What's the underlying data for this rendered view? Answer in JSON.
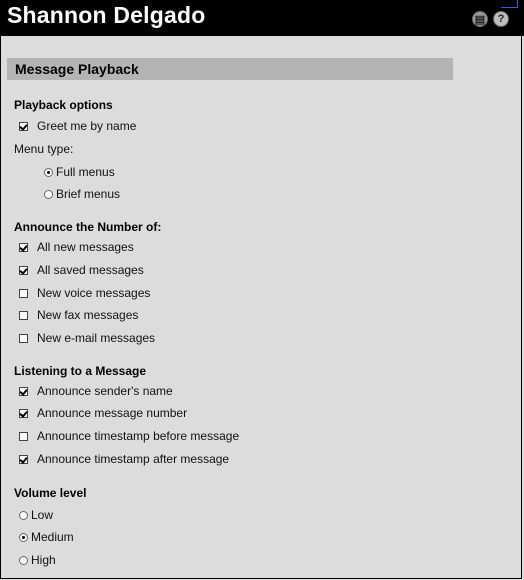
{
  "header": {
    "title": "Shannon Delgado",
    "print_icon": "print-icon",
    "help_icon": "help-icon",
    "help_glyph": "?"
  },
  "main": {
    "section_title": "Message Playback",
    "playback_options": {
      "title": "Playback options",
      "greet_by_name": {
        "label": "Greet me by name",
        "checked": true
      },
      "menu_type_label": "Menu type:",
      "menu_types": [
        {
          "label": "Full menus",
          "selected": true
        },
        {
          "label": "Brief menus",
          "selected": false
        }
      ]
    },
    "announce_number": {
      "title": "Announce the Number of:",
      "items": [
        {
          "label": "All new messages",
          "checked": true
        },
        {
          "label": "All saved messages",
          "checked": true
        },
        {
          "label": "New voice messages",
          "checked": false
        },
        {
          "label": "New fax messages",
          "checked": false
        },
        {
          "label": "New e-mail messages",
          "checked": false
        }
      ]
    },
    "listening": {
      "title": "Listening to a Message",
      "items": [
        {
          "label": "Announce sender's name",
          "checked": true
        },
        {
          "label": "Announce message number",
          "checked": true
        },
        {
          "label": "Announce timestamp before message",
          "checked": false
        },
        {
          "label": "Announce timestamp after message",
          "checked": true
        }
      ]
    },
    "volume": {
      "title": "Volume level",
      "options": [
        {
          "label": "Low",
          "selected": false
        },
        {
          "label": "Medium",
          "selected": true
        },
        {
          "label": "High",
          "selected": false
        }
      ]
    }
  },
  "colors": {
    "header_bg": "#000000",
    "page_bg": "#dcdcdc",
    "section_bar": "#b4b4b4"
  }
}
